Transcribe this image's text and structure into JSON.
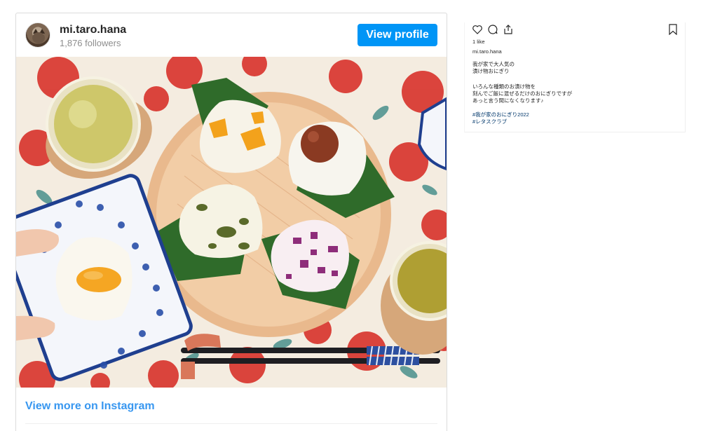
{
  "embed": {
    "username": "mi.taro.hana",
    "followers": "1,876 followers",
    "view_profile_label": "View profile",
    "view_more_label": "View more on Instagram"
  },
  "side": {
    "likes": "1 like",
    "username": "mi.taro.hana",
    "caption_lines": [
      "我が家で大人気の",
      "漬け物おにぎり",
      "",
      "いろんな種類のお漬け物を",
      "刻んでご飯に混ぜるだけのおにぎりですが",
      "あっと言う間になくなります♪"
    ],
    "hashtags": [
      "#我が家のおにぎり2022",
      "#レタスクラブ"
    ]
  },
  "colors": {
    "accent": "#0095f6",
    "link": "#3897f0",
    "hashtag": "#00376b",
    "tablecloth": "#f4ece0",
    "flower": "#d8362f"
  },
  "icons": [
    "heart-icon",
    "comment-icon",
    "share-icon",
    "bookmark-icon"
  ]
}
